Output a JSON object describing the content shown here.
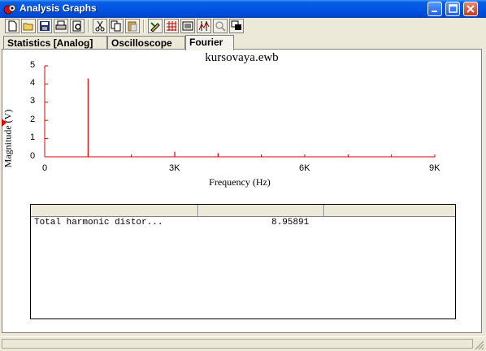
{
  "window": {
    "title": "Analysis Graphs",
    "app_icon": "analysis-app-icon",
    "controls": [
      "minimize-icon",
      "maximize-icon",
      "close-icon"
    ]
  },
  "toolbar": {
    "buttons": [
      "new-icon",
      "open-icon",
      "save-icon",
      "print-icon",
      "print-preview-icon",
      "cut-icon",
      "copy-icon",
      "paste-icon",
      "properties-icon",
      "toggle-grid-icon",
      "toggle-legend-icon",
      "show-cursors-icon",
      "zoom-icon",
      "restore-icon"
    ]
  },
  "tabs": [
    {
      "label": "Statistics [Analog]",
      "active": false
    },
    {
      "label": "Oscilloscope",
      "active": false
    },
    {
      "label": "Fourier",
      "active": true
    }
  ],
  "chart_data": {
    "type": "bar",
    "title": "kursovaya.ewb",
    "xlabel": "Frequency (Hz)",
    "ylabel": "Magnitude (V)",
    "xlim": [
      0,
      9000
    ],
    "ylim": [
      0,
      5
    ],
    "x_ticks": [
      "0",
      "3K",
      "6K",
      "9K"
    ],
    "y_ticks": [
      "0",
      "1",
      "2",
      "3",
      "4",
      "5"
    ],
    "x": [
      1000,
      2000,
      3000,
      4000,
      5000,
      6000,
      7000,
      8000
    ],
    "values": [
      4.3,
      0.05,
      0.28,
      0.2,
      0.06,
      0.03,
      0.05,
      0.03
    ],
    "color": "#e00000",
    "grid": false
  },
  "table": {
    "columns": [
      "",
      "",
      ""
    ],
    "rows": [
      {
        "label": "Total harmonic distor...",
        "value": "8.95891"
      }
    ]
  }
}
